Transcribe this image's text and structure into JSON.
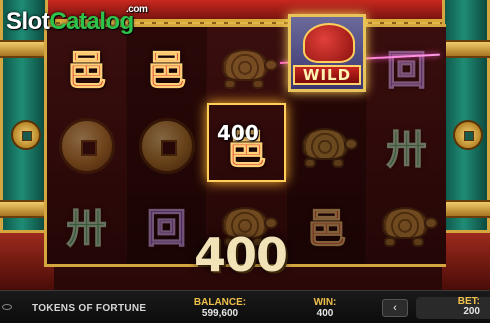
{
  "logo": {
    "slot": "Slot",
    "catalog": "Catalog",
    "com": ".com"
  },
  "game": {
    "title": "TOKENS OF FORTUNE"
  },
  "reels": [
    [
      "red-coin-hanzi",
      "bronze-coin",
      "green-hanzi"
    ],
    [
      "red-coin-hanzi",
      "bronze-coin",
      "purple-hanzi"
    ],
    [
      "gold-turtle",
      "red-coin-hanzi",
      "gold-turtle"
    ],
    [
      "wild-dragon",
      "gold-turtle",
      "red-coin-hanzi"
    ],
    [
      "purple-hanzi",
      "green-hanzi",
      "gold-turtle"
    ]
  ],
  "wild": {
    "label": "WILD"
  },
  "win": {
    "line_amount": "400",
    "total_amount": "400"
  },
  "footer": {
    "balance_label": "BALANCE:",
    "balance_value": "599,600",
    "win_label": "WIN:",
    "win_value": "400",
    "bet_label": "BET:",
    "bet_value": "200",
    "bet_prev_arrow": "‹"
  }
}
